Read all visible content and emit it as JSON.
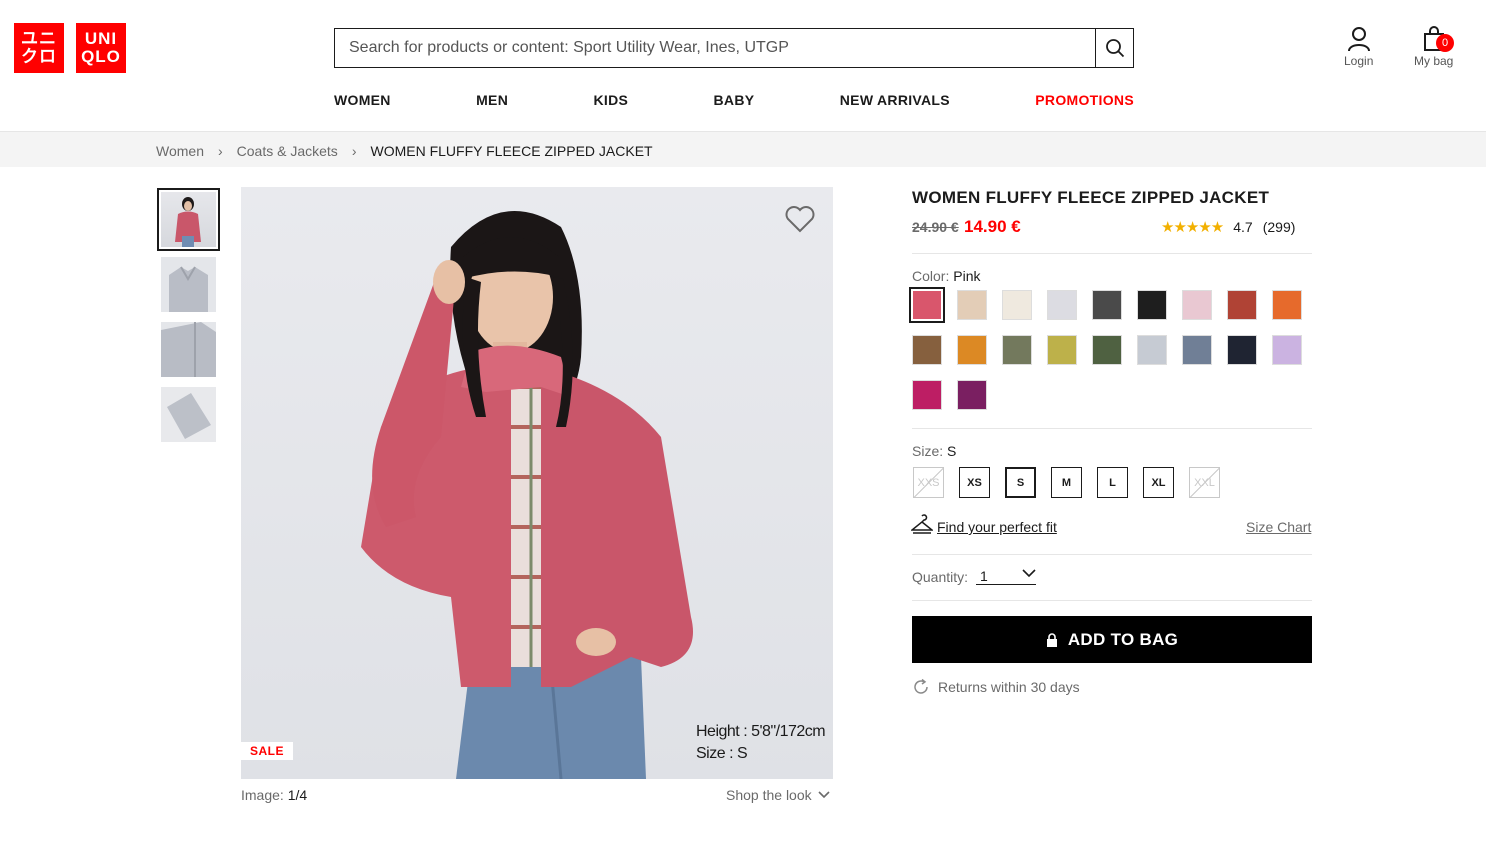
{
  "header": {
    "logo_top": "ユニ",
    "logo_bottom": "クロ",
    "logo_en_top": "UNI",
    "logo_en_bottom": "QLO",
    "search_placeholder": "Search for products or content: Sport Utility Wear, Ines, UTGP",
    "login_label": "Login",
    "bag_label": "My bag",
    "bag_count": "0"
  },
  "nav": {
    "items": [
      "WOMEN",
      "MEN",
      "KIDS",
      "BABY",
      "NEW ARRIVALS",
      "PROMOTIONS"
    ],
    "promo_color": "#ff0000"
  },
  "breadcrumb": {
    "items": [
      "Women",
      "Coats & Jackets",
      "WOMEN FLUFFY FLEECE ZIPPED JACKET"
    ]
  },
  "gallery": {
    "sale_label": "SALE",
    "caption_height": "Height : 5'8\"/172cm",
    "caption_size": "Size : S",
    "image_label": "Image:",
    "image_index": "1/4",
    "shop_look": "Shop the look"
  },
  "product": {
    "title": "WOMEN FLUFFY FLEECE ZIPPED JACKET",
    "old_price": "24.90 €",
    "new_price": "14.90 €",
    "stars": "★★★★★",
    "rating": "4.7",
    "review_count": "(299)",
    "color_label": "Color:",
    "color_value": "Pink",
    "colors": [
      "#d9566c",
      "#e3cdb7",
      "#efe9df",
      "#dcdce2",
      "#4a4a4a",
      "#1e1e1e",
      "#e9c8d2",
      "#b04335",
      "#e66a2c",
      "#86603e",
      "#dc8924",
      "#73795d",
      "#bdb14a",
      "#4f6141",
      "#c6cbd3",
      "#707f96",
      "#1f2432",
      "#cbb3e1",
      "#bd1e64",
      "#7a1f61"
    ],
    "size_label": "Size:",
    "size_value": "S",
    "sizes": [
      "XXS",
      "XS",
      "S",
      "M",
      "L",
      "XL",
      "XXL"
    ],
    "fit_link": "Find your perfect fit",
    "size_chart": "Size Chart",
    "quantity_label": "Quantity:",
    "quantity_value": "1",
    "add_to_bag": "ADD TO BAG",
    "returns": "Returns within 30 days"
  }
}
